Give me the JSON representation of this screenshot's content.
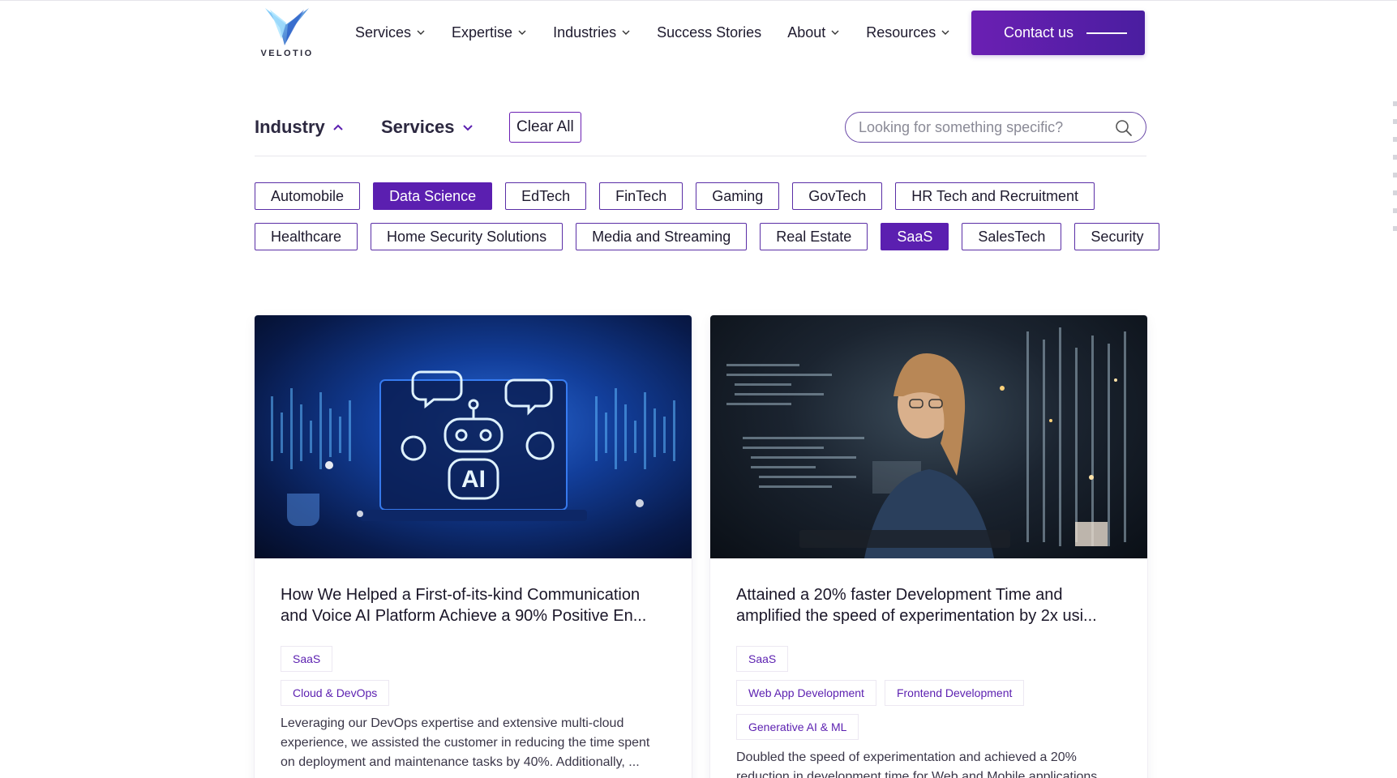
{
  "header": {
    "logo_text": "VELOTIO",
    "nav": [
      {
        "label": "Services",
        "dropdown": true
      },
      {
        "label": "Expertise",
        "dropdown": true
      },
      {
        "label": "Industries",
        "dropdown": true
      },
      {
        "label": "Success Stories",
        "dropdown": false
      },
      {
        "label": "About",
        "dropdown": true
      },
      {
        "label": "Resources",
        "dropdown": true
      }
    ],
    "contact_label": "Contact us"
  },
  "filters": {
    "industry_label": "Industry",
    "services_label": "Services",
    "clear_all_label": "Clear All",
    "search_placeholder": "Looking for something specific?",
    "chips_row1": [
      {
        "label": "Automobile",
        "active": false
      },
      {
        "label": "Data Science",
        "active": true
      },
      {
        "label": "EdTech",
        "active": false
      },
      {
        "label": "FinTech",
        "active": false
      },
      {
        "label": "Gaming",
        "active": false
      },
      {
        "label": "GovTech",
        "active": false
      },
      {
        "label": "HR Tech and Recruitment",
        "active": false
      }
    ],
    "chips_row2": [
      {
        "label": "Healthcare",
        "active": false
      },
      {
        "label": "Home Security Solutions",
        "active": false
      },
      {
        "label": "Media and Streaming",
        "active": false
      },
      {
        "label": "Real Estate",
        "active": false
      },
      {
        "label": "SaaS",
        "active": true
      },
      {
        "label": "SalesTech",
        "active": false
      },
      {
        "label": "Security",
        "active": false
      }
    ]
  },
  "cards": [
    {
      "title": "How We Helped a First-of-its-kind Communication and Voice AI Platform Achieve a 90% Positive En...",
      "tag_rows": [
        [
          "SaaS"
        ],
        [
          "Cloud & DevOps"
        ]
      ],
      "description": "Leveraging our DevOps expertise and extensive multi-cloud experience, we assisted the customer in reducing the time spent on deployment and maintenance tasks by 40%. Additionally, ...",
      "image_text": "AI"
    },
    {
      "title": "Attained a 20% faster Development Time and amplified the speed of experimentation by 2x usi...",
      "tag_rows": [
        [
          "SaaS"
        ],
        [
          "Web App Development",
          "Frontend Development"
        ],
        [
          "Generative AI & ML"
        ]
      ],
      "description": "Doubled the speed of experimentation and achieved a 20% reduction in development time for Web and Mobile applications..."
    }
  ],
  "colors": {
    "accent": "#5b1fb0",
    "accent_dark": "#4a1ea0",
    "text": "#1e1a2e"
  }
}
